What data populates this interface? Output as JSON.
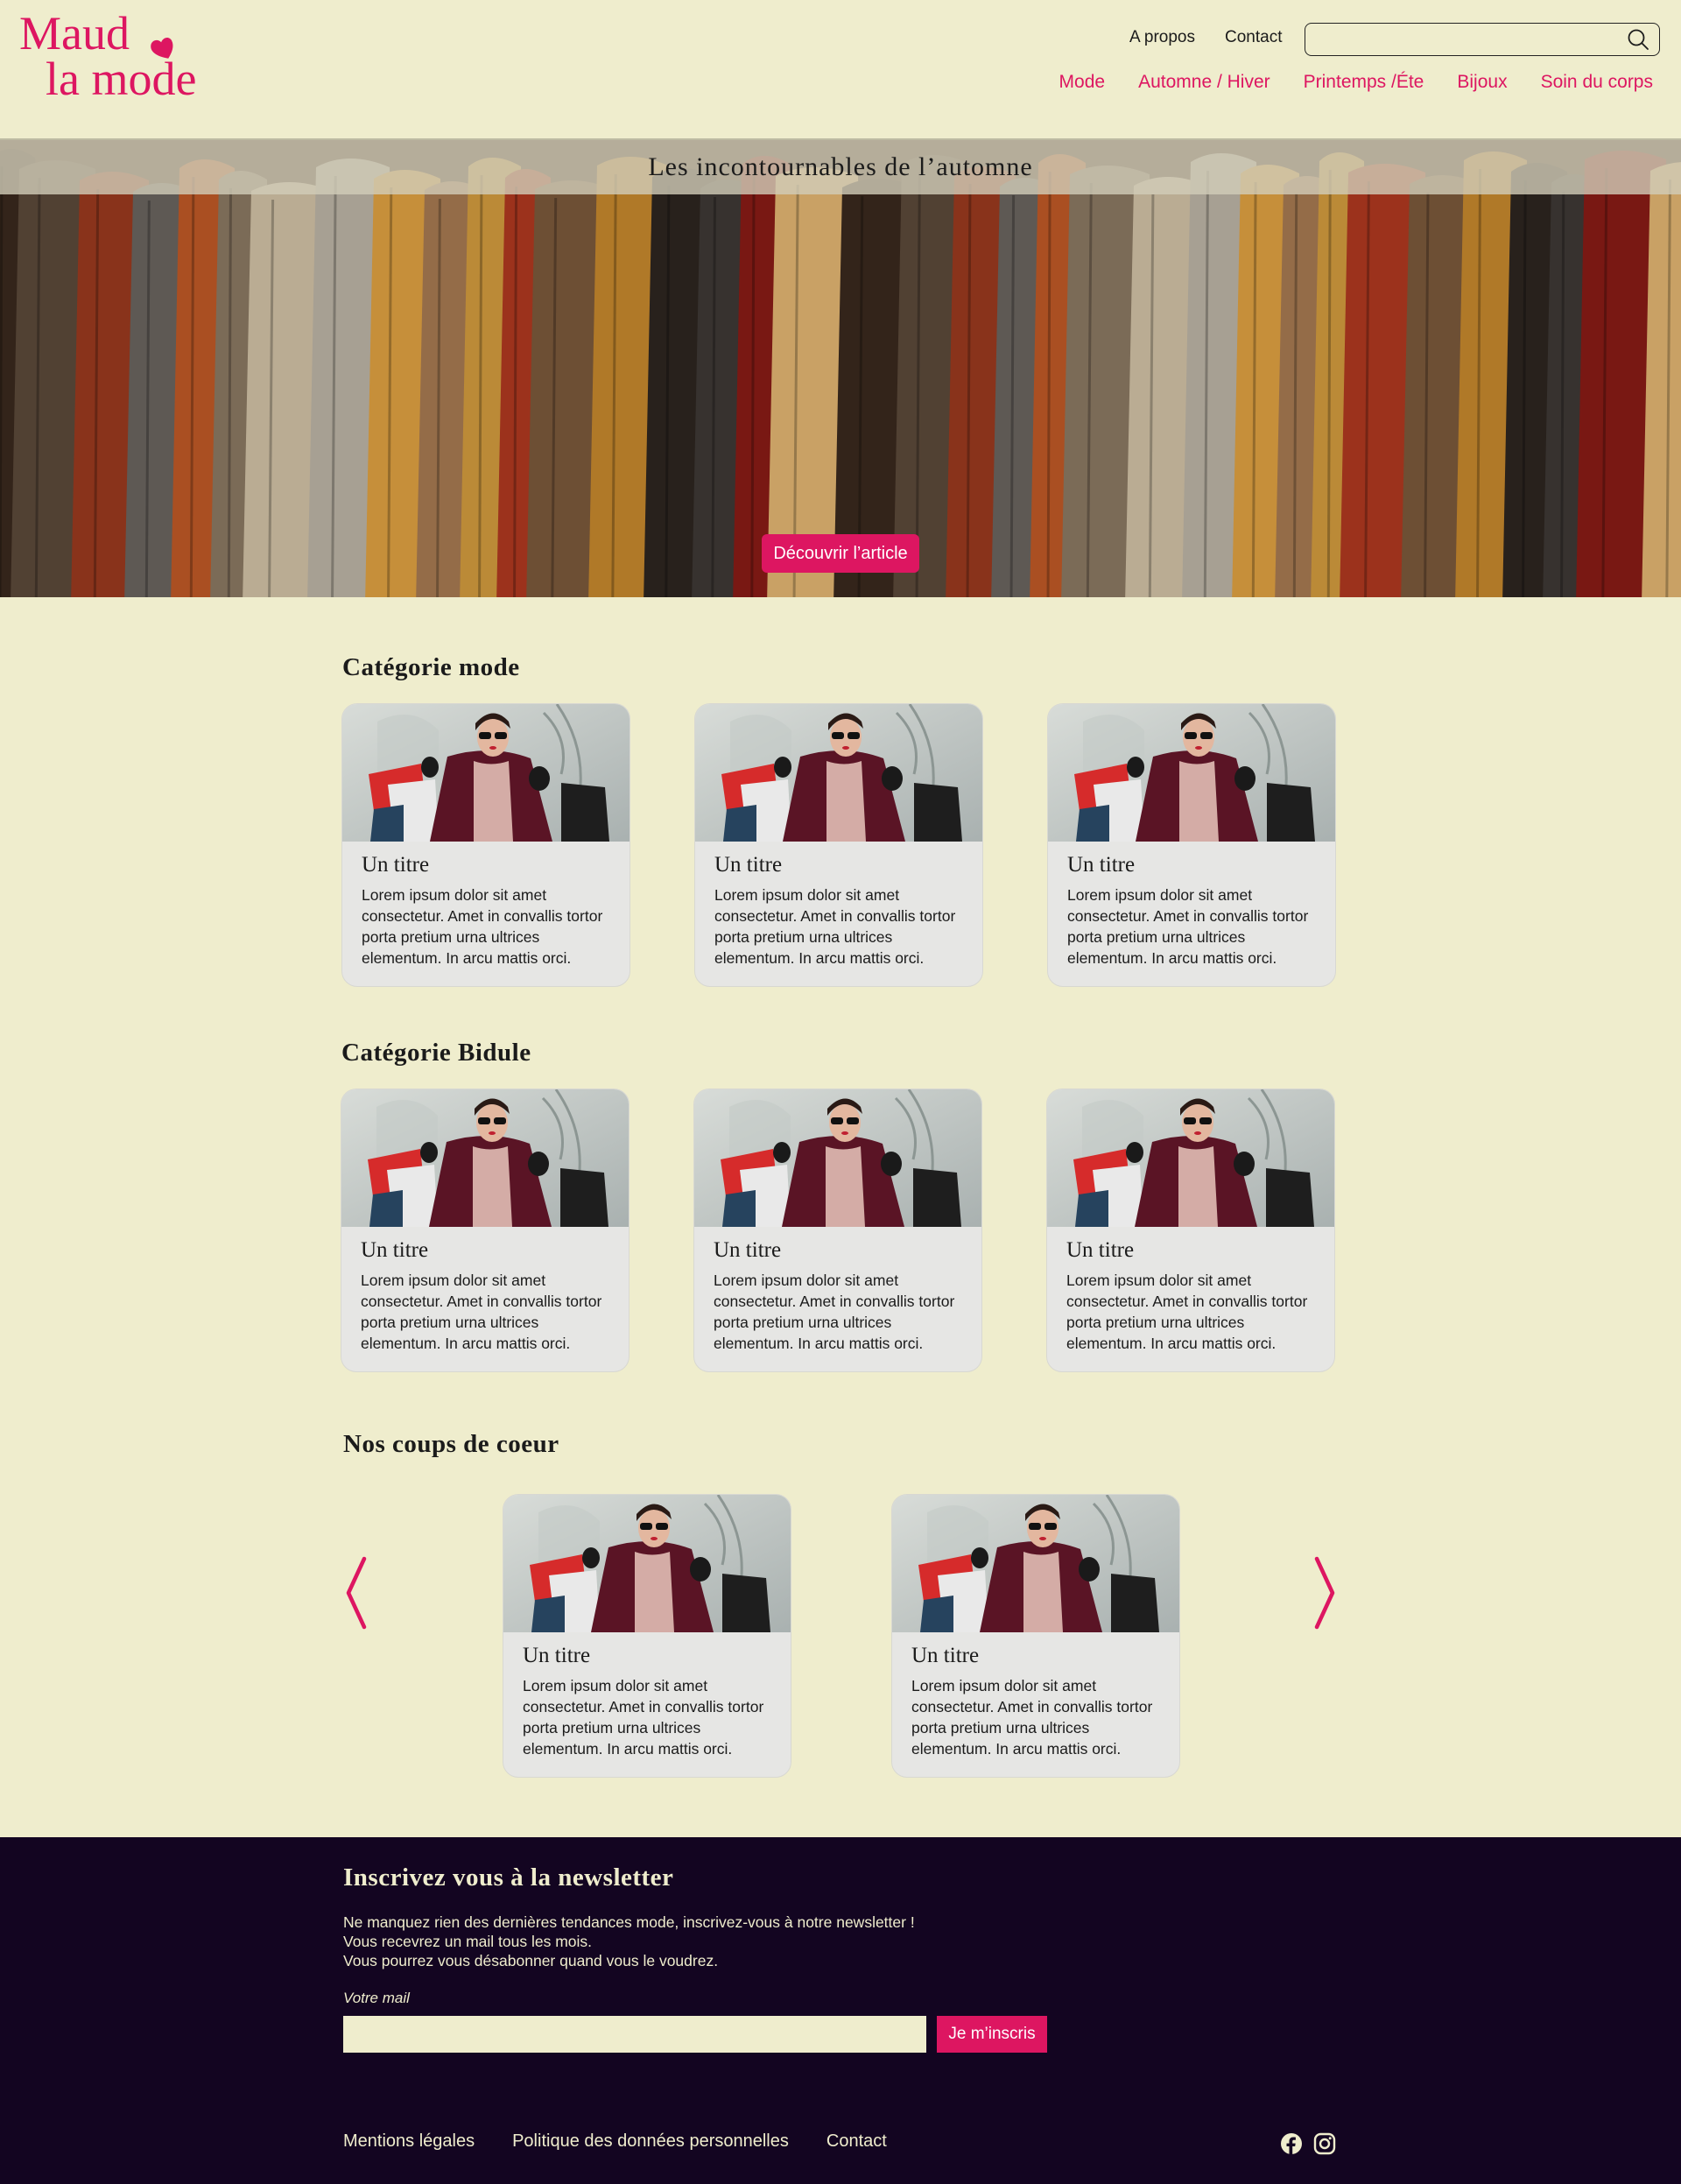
{
  "brand": {
    "line1": "Maud",
    "line2": "la mode",
    "accent": "#dd1661"
  },
  "header": {
    "top_links": [
      "A propos",
      "Contact"
    ],
    "search": {
      "placeholder": "",
      "icon": "search-icon"
    },
    "nav": [
      "Mode",
      "Automne / Hiver",
      "Printemps /Éte",
      "Bijoux",
      "Soin du corps"
    ]
  },
  "hero": {
    "title": "Les incontournables de l’automne",
    "button": "Découvrir l’article"
  },
  "sections": [
    {
      "title": "Catégorie mode",
      "cards": [
        {
          "title": "Un titre",
          "text": "Lorem ipsum dolor sit amet consectetur. Amet in convallis tortor porta pretium urna ultrices elementum. In arcu mattis orci."
        },
        {
          "title": "Un titre",
          "text": "Lorem ipsum dolor sit amet consectetur. Amet in convallis tortor porta pretium urna ultrices elementum. In arcu mattis orci."
        },
        {
          "title": "Un titre",
          "text": "Lorem ipsum dolor sit amet consectetur. Amet in convallis tortor porta pretium urna ultrices elementum. In arcu mattis orci."
        }
      ]
    },
    {
      "title": "Catégorie Bidule",
      "cards": [
        {
          "title": "Un titre",
          "text": "Lorem ipsum dolor sit amet consectetur. Amet in convallis tortor porta pretium urna ultrices elementum. In arcu mattis orci."
        },
        {
          "title": "Un titre",
          "text": "Lorem ipsum dolor sit amet consectetur. Amet in convallis tortor porta pretium urna ultrices elementum. In arcu mattis orci."
        },
        {
          "title": "Un titre",
          "text": "Lorem ipsum dolor sit amet consectetur. Amet in convallis tortor porta pretium urna ultrices elementum. In arcu mattis orci."
        }
      ]
    },
    {
      "title": "Nos coups de coeur",
      "cards": [
        {
          "title": "Un titre",
          "text": "Lorem ipsum dolor sit amet consectetur. Amet in convallis tortor porta pretium urna ultrices elementum. In arcu mattis orci."
        },
        {
          "title": "Un titre",
          "text": "Lorem ipsum dolor sit amet consectetur. Amet in convallis tortor porta pretium urna ultrices elementum. In arcu mattis orci."
        }
      ]
    }
  ],
  "newsletter": {
    "title": "Inscrivez vous à la newsletter",
    "lines": [
      "Ne manquez rien des dernières tendances mode, inscrivez-vous à notre newsletter !",
      "Vous recevrez un mail tous les mois.",
      "Vous pourrez vous désabonner quand vous le voudrez."
    ],
    "label": "Votre mail",
    "placeholder": "",
    "button": "Je m’inscris"
  },
  "footer": {
    "links": [
      "Mentions légales",
      "Politique des données personnelles",
      "Contact"
    ],
    "social": [
      "facebook-icon",
      "instagram-icon"
    ]
  },
  "colors": {
    "background": "#efedcd",
    "footer": "#130521",
    "accent": "#dd1661",
    "card": "#e6e6e4"
  }
}
